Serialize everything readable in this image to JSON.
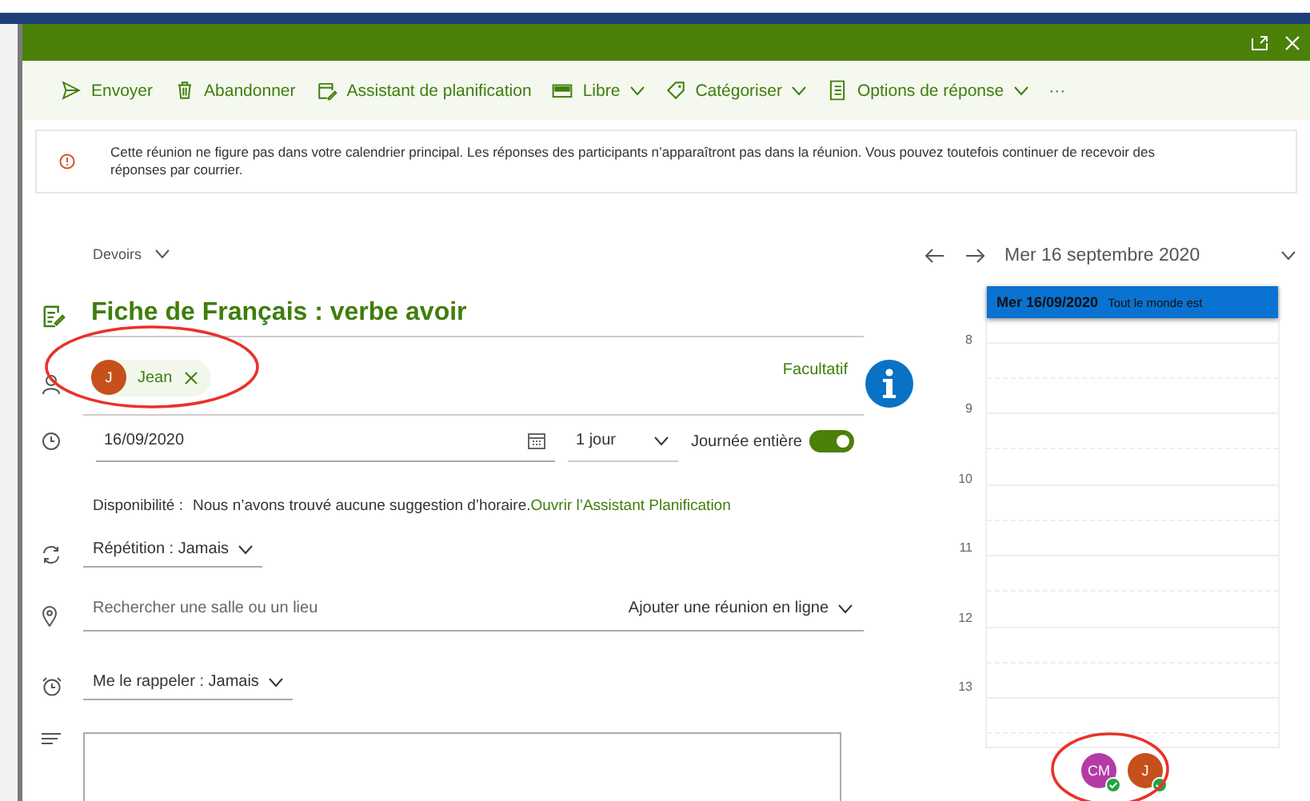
{
  "toolbar": [
    {
      "label": "Envoyer",
      "has_menu": false
    },
    {
      "label": "Abandonner",
      "has_menu": false
    },
    {
      "label": "Assistant de planification",
      "has_menu": false
    },
    {
      "label": "Libre",
      "has_menu": true
    },
    {
      "label": "Catégoriser",
      "has_menu": true
    },
    {
      "label": "Options de réponse",
      "has_menu": true
    },
    {
      "label": "···",
      "has_menu": false
    }
  ],
  "notice": {
    "text": "Cette réunion ne figure pas dans votre calendrier principal. Les réponses des participants n’apparaîtront pas dans la réunion. Vous pouvez toutefois continuer de recevoir des réponses par courrier."
  },
  "calendar_picker": {
    "label": "Devoirs"
  },
  "title": "Fiche de Français : verbe avoir",
  "attendees": [
    {
      "initials": "J",
      "name": "Jean",
      "color": "#c5501b"
    }
  ],
  "optional_label": "Facultatif",
  "date": {
    "value": "16/09/2020",
    "duration": "1 jour",
    "all_day_label": "Journée entière",
    "all_day_on": true
  },
  "availability": {
    "label": "Disponibilité :",
    "message": "Nous n’avons trouvé aucune suggestion d’horaire.",
    "link": "Ouvrir l’Assistant Planification"
  },
  "repeat": "Répétition : Jamais",
  "location": {
    "placeholder": "Rechercher une salle ou un lieu",
    "online": "Ajouter une réunion en ligne"
  },
  "reminder": "Me le rappeler : Jamais",
  "calendar": {
    "date": "Mer 16 septembre 2020",
    "event": {
      "date": "Mer 16/09/2020",
      "text": "Tout le monde est"
    },
    "hours": [
      "8",
      "9",
      "10",
      "11",
      "12",
      "13"
    ],
    "people": [
      {
        "initials": "CM",
        "color": "#b63aa5"
      },
      {
        "initials": "J",
        "color": "#c5501b"
      }
    ]
  }
}
